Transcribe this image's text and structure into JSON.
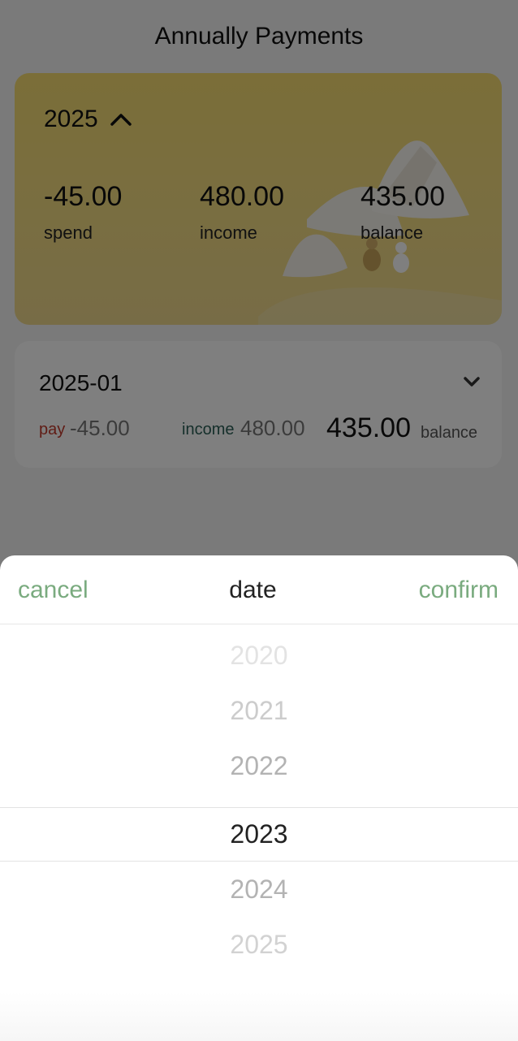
{
  "header": {
    "title": "Annually Payments"
  },
  "summary": {
    "year": "2025",
    "spend_value": "-45.00",
    "spend_label": "spend",
    "income_value": "480.00",
    "income_label": "income",
    "balance_value": "435.00",
    "balance_label": "balance"
  },
  "months": [
    {
      "label": "2025-01",
      "pay_label": "pay",
      "pay_value": "-45.00",
      "income_label": "income",
      "income_value": "480.00",
      "balance_value": "435.00",
      "balance_label": "balance"
    }
  ],
  "picker": {
    "cancel_label": "cancel",
    "title": "date",
    "confirm_label": "confirm",
    "options": [
      "2020",
      "2021",
      "2022",
      "2023",
      "2024",
      "2025"
    ],
    "selected": "2023"
  },
  "colors": {
    "accent_green": "#7aab7f",
    "pay_red": "#c0392b",
    "income_teal": "#2a5f56",
    "card_yellow": "#f6dc71"
  },
  "icons": {
    "year_toggle": "chevron-up-icon",
    "month_expand": "chevron-down-icon"
  }
}
